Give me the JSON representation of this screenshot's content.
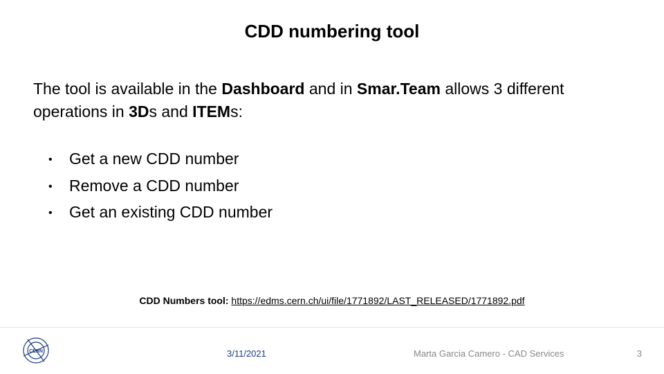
{
  "title": "CDD numbering tool",
  "intro": {
    "part1": "The tool is available in the ",
    "bold1": "Dashboard",
    "part2": " and in ",
    "bold2": "Smar.Team",
    "part3": " allows 3 different operations in ",
    "bold3": "3D",
    "part4": "s and ",
    "bold4": "ITEM",
    "part5": "s:"
  },
  "bullets": [
    "Get a new CDD number",
    "Remove a CDD number",
    "Get an existing CDD number"
  ],
  "reference": {
    "label": "CDD Numbers tool: ",
    "url": "https://edms.cern.ch/ui/file/1771892/LAST_RELEASED/1771892.pdf"
  },
  "footer": {
    "date": "3/11/2021",
    "author": "Marta Garcia Camero - CAD Services",
    "page": "3",
    "logo_name": "CERN"
  }
}
